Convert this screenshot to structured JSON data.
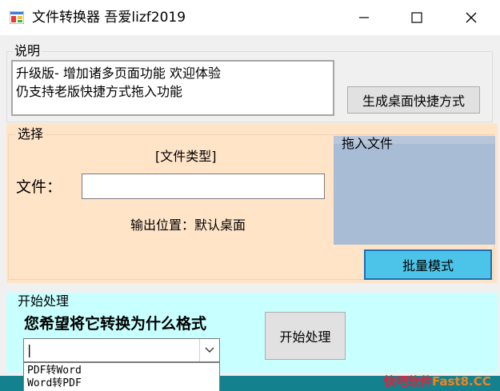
{
  "window": {
    "title": "文件转换器  吾爱lizf2019",
    "controls": {
      "minimize": "—",
      "maximize": "☐",
      "close": "✕"
    }
  },
  "description": {
    "legend": "说明",
    "lines": [
      "升级版- 增加诸多页面功能 欢迎体验",
      "仍支持老版快捷方式拖入功能"
    ],
    "shortcut_button": "生成桌面快捷方式"
  },
  "select": {
    "legend": "选择",
    "file_type": "[文件类型]",
    "file_label": "文件：",
    "file_value": "",
    "output_location": "输出位置：默认桌面",
    "drop_legend": "拖入文件",
    "batch_button": "批量模式"
  },
  "process": {
    "legend": "开始处理",
    "question": "您希望将它转换为什么格式",
    "combo_value": "|",
    "options": [
      "PDF转Word",
      "Word转PDF"
    ],
    "start_button": "开始处理"
  },
  "watermark": {
    "part1": "快吧软件",
    "part2": "Fast8.CC"
  },
  "colors": {
    "select_panel": "#ffe4c8",
    "drop_panel": "#a9bcd6",
    "process_panel": "#c8ffff",
    "batch_button": "#4cc3e8",
    "bottom_strip": "#14828e",
    "watermark_red": "#e8203a",
    "watermark_orange": "#f5821f"
  }
}
